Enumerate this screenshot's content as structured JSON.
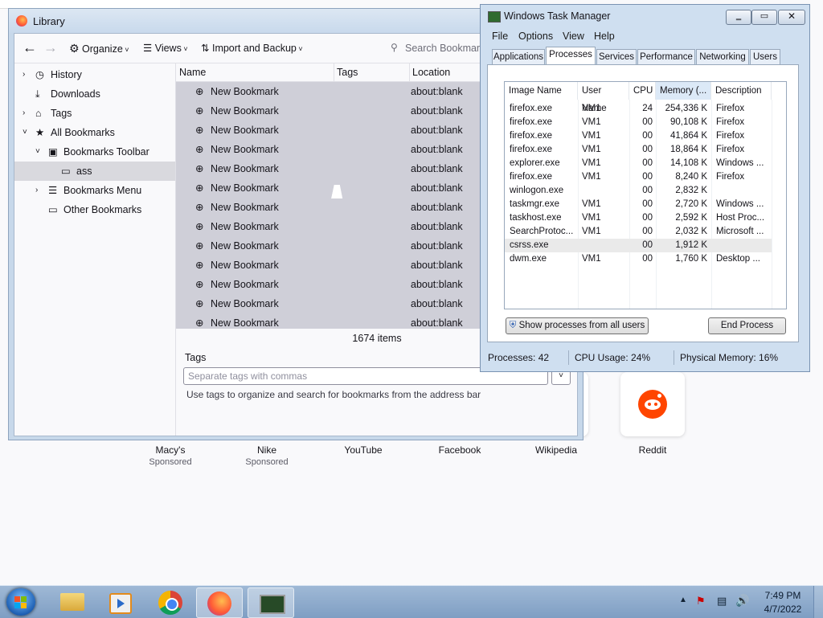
{
  "newtab": {
    "tiles": [
      {
        "label": "Macy's",
        "sub": "Sponsored"
      },
      {
        "label": "Nike",
        "sub": "Sponsored"
      },
      {
        "label": "YouTube",
        "sub": ""
      },
      {
        "label": "Facebook",
        "sub": ""
      },
      {
        "label": "Wikipedia",
        "sub": ""
      },
      {
        "label": "Reddit",
        "sub": ""
      }
    ]
  },
  "library": {
    "title": "Library",
    "toolbar": {
      "organize": "Organize",
      "views": "Views",
      "import_backup": "Import and Backup",
      "search_placeholder": "Search Bookmarks"
    },
    "tree": [
      {
        "label": "History",
        "icon": "clock-icon"
      },
      {
        "label": "Downloads",
        "icon": "download-icon"
      },
      {
        "label": "Tags",
        "icon": "tag-icon"
      },
      {
        "label": "All Bookmarks",
        "icon": "star-icon"
      },
      {
        "label": "Bookmarks Toolbar",
        "icon": "toolbar-icon"
      },
      {
        "label": "ass",
        "icon": "folder-icon"
      },
      {
        "label": "Bookmarks Menu",
        "icon": "menu-icon"
      },
      {
        "label": "Other Bookmarks",
        "icon": "folder-icon"
      }
    ],
    "columns": {
      "name": "Name",
      "tags": "Tags",
      "location": "Location"
    },
    "rows": [
      {
        "name": "New Bookmark",
        "location": "about:blank"
      },
      {
        "name": "New Bookmark",
        "location": "about:blank"
      },
      {
        "name": "New Bookmark",
        "location": "about:blank"
      },
      {
        "name": "New Bookmark",
        "location": "about:blank"
      },
      {
        "name": "New Bookmark",
        "location": "about:blank"
      },
      {
        "name": "New Bookmark",
        "location": "about:blank"
      },
      {
        "name": "New Bookmark",
        "location": "about:blank"
      },
      {
        "name": "New Bookmark",
        "location": "about:blank"
      },
      {
        "name": "New Bookmark",
        "location": "about:blank"
      },
      {
        "name": "New Bookmark",
        "location": "about:blank"
      },
      {
        "name": "New Bookmark",
        "location": "about:blank"
      },
      {
        "name": "New Bookmark",
        "location": "about:blank"
      },
      {
        "name": "New Bookmark",
        "location": "about:blank"
      }
    ],
    "item_count": "1674 items",
    "tags_label": "Tags",
    "tags_placeholder": "Separate tags with commas",
    "tags_hint": "Use tags to organize and search for bookmarks from the address bar"
  },
  "taskmgr": {
    "title": "Windows Task Manager",
    "menu": [
      "File",
      "Options",
      "View",
      "Help"
    ],
    "tabs": [
      "Applications",
      "Processes",
      "Services",
      "Performance",
      "Networking",
      "Users"
    ],
    "active_tab": "Processes",
    "columns": [
      "Image Name",
      "User Name",
      "CPU",
      "Memory (...",
      "Description"
    ],
    "processes": [
      {
        "image": "firefox.exe",
        "user": "VM1",
        "cpu": "24",
        "mem": "254,336 K",
        "desc": "Firefox"
      },
      {
        "image": "firefox.exe",
        "user": "VM1",
        "cpu": "00",
        "mem": "90,108 K",
        "desc": "Firefox"
      },
      {
        "image": "firefox.exe",
        "user": "VM1",
        "cpu": "00",
        "mem": "41,864 K",
        "desc": "Firefox"
      },
      {
        "image": "firefox.exe",
        "user": "VM1",
        "cpu": "00",
        "mem": "18,864 K",
        "desc": "Firefox"
      },
      {
        "image": "explorer.exe",
        "user": "VM1",
        "cpu": "00",
        "mem": "14,108 K",
        "desc": "Windows ..."
      },
      {
        "image": "firefox.exe",
        "user": "VM1",
        "cpu": "00",
        "mem": "8,240 K",
        "desc": "Firefox"
      },
      {
        "image": "winlogon.exe",
        "user": "",
        "cpu": "00",
        "mem": "2,832 K",
        "desc": ""
      },
      {
        "image": "taskmgr.exe",
        "user": "VM1",
        "cpu": "00",
        "mem": "2,720 K",
        "desc": "Windows ..."
      },
      {
        "image": "taskhost.exe",
        "user": "VM1",
        "cpu": "00",
        "mem": "2,592 K",
        "desc": "Host Proc..."
      },
      {
        "image": "SearchProtoc...",
        "user": "VM1",
        "cpu": "00",
        "mem": "2,032 K",
        "desc": "Microsoft ..."
      },
      {
        "image": "csrss.exe",
        "user": "",
        "cpu": "00",
        "mem": "1,912 K",
        "desc": ""
      },
      {
        "image": "dwm.exe",
        "user": "VM1",
        "cpu": "00",
        "mem": "1,760 K",
        "desc": "Desktop ..."
      }
    ],
    "show_all_button": "Show processes from all users",
    "end_process_button": "End Process",
    "status": {
      "processes": "Processes: 42",
      "cpu": "CPU Usage: 24%",
      "memory": "Physical Memory: 16%"
    }
  },
  "taskbar": {
    "time": "7:49 PM",
    "date": "4/7/2022"
  }
}
